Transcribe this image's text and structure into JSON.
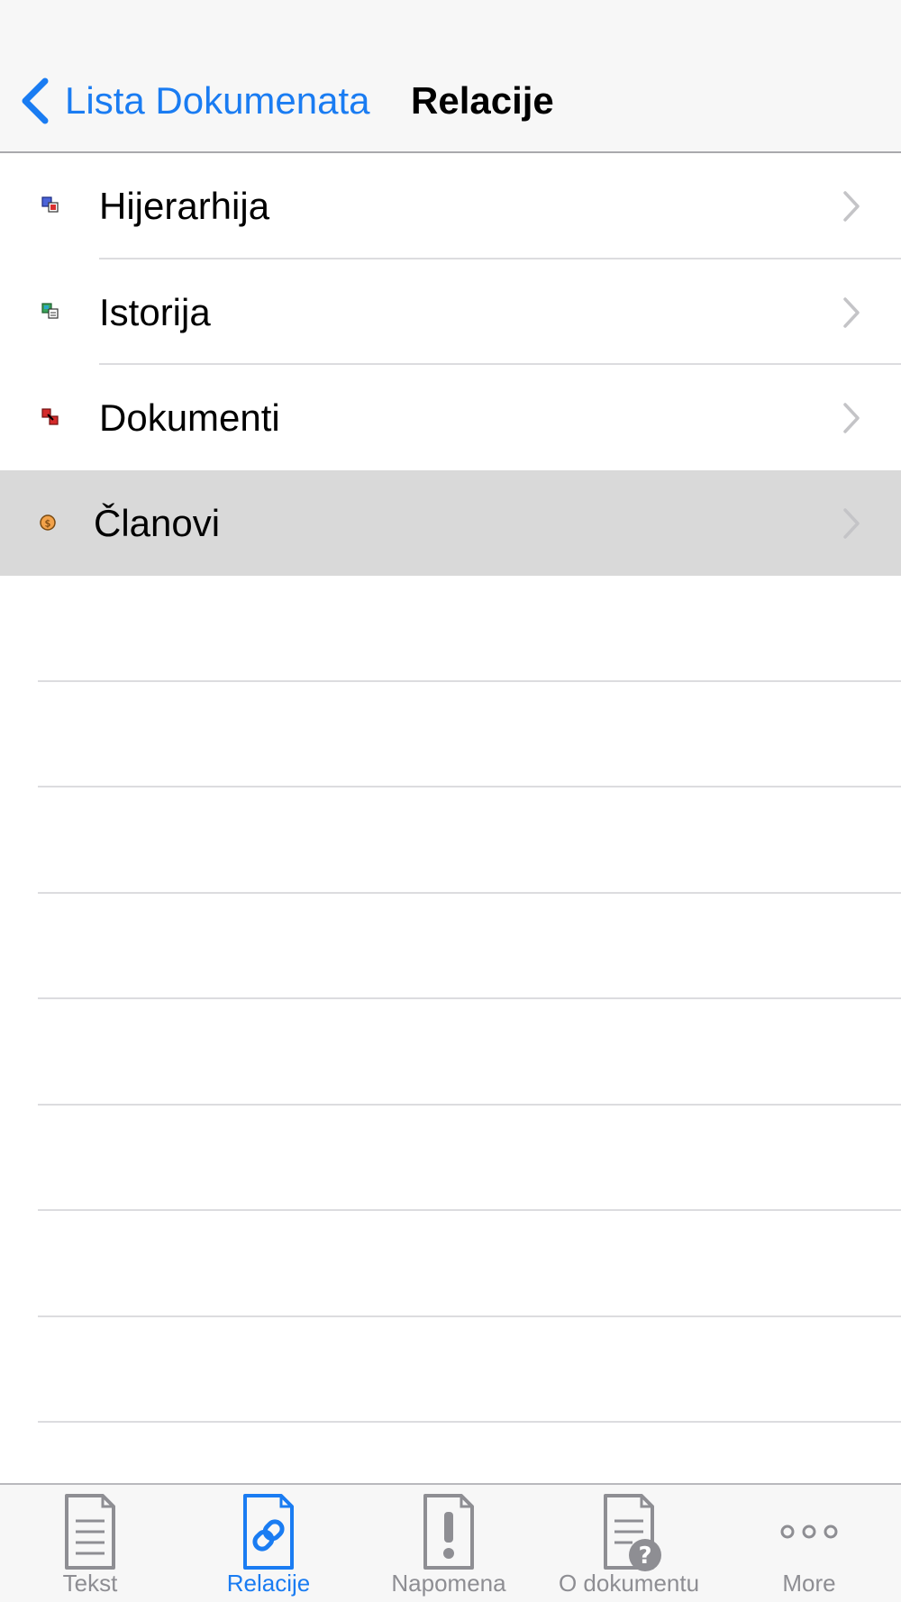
{
  "navbar": {
    "back_label": "Lista Dokumenata",
    "title": "Relacije",
    "back_icon": "chevron-left-icon"
  },
  "list": {
    "items": [
      {
        "label": "Hijerarhija",
        "icon": "hierarchy-icon",
        "selected": false
      },
      {
        "label": "Istorija",
        "icon": "history-icon",
        "selected": false
      },
      {
        "label": "Dokumenti",
        "icon": "documents-link-icon",
        "selected": false
      },
      {
        "label": "Članovi",
        "icon": "members-icon",
        "selected": true
      }
    ],
    "disclosure_icon": "chevron-right-icon"
  },
  "tabbar": {
    "tabs": [
      {
        "label": "Tekst",
        "icon": "document-text-icon",
        "active": false
      },
      {
        "label": "Relacije",
        "icon": "document-link-icon",
        "active": true
      },
      {
        "label": "Napomena",
        "icon": "document-exclamation-icon",
        "active": false
      },
      {
        "label": "O dokumentu",
        "icon": "document-question-icon",
        "active": false
      },
      {
        "label": "More",
        "icon": "more-dots-icon",
        "active": false
      }
    ]
  },
  "colors": {
    "accent": "#1a7cf2",
    "inactive": "#8e8e93",
    "selected_row": "#d9d9d9",
    "navbar_bg": "#f7f7f7"
  }
}
